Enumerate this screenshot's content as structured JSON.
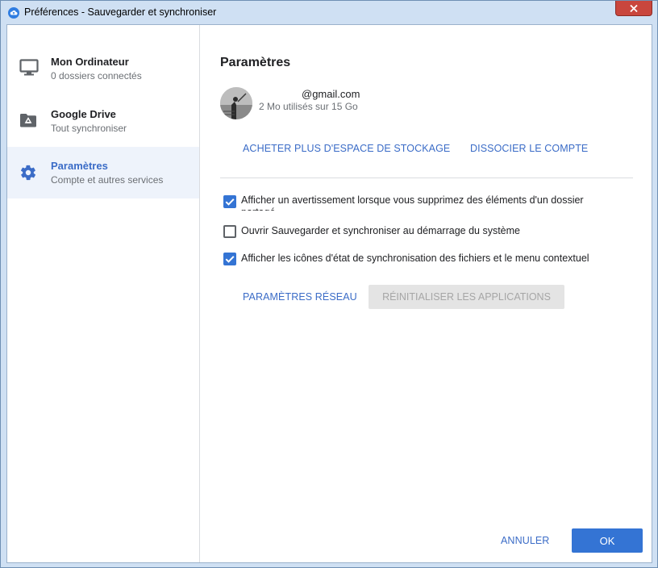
{
  "window": {
    "title": "Préférences - Sauvegarder et synchroniser"
  },
  "sidebar": {
    "items": [
      {
        "title": "Mon Ordinateur",
        "subtitle": "0 dossiers connectés",
        "icon": "monitor-icon"
      },
      {
        "title": "Google Drive",
        "subtitle": "Tout synchroniser",
        "icon": "drive-folder-icon"
      },
      {
        "title": "Paramètres",
        "subtitle": "Compte et autres services",
        "icon": "gear-icon"
      }
    ],
    "active_index": 2
  },
  "settings": {
    "heading": "Paramètres",
    "account": {
      "email": "@gmail.com",
      "usage": "2 Mo utilisés sur 15 Go"
    },
    "buy_storage": "ACHETER PLUS D'ESPACE DE STOCKAGE",
    "disconnect": "DISSOCIER LE COMPTE",
    "options": [
      {
        "label": "Afficher un avertissement lorsque vous supprimez des éléments d'un dossier partagé",
        "checked": true
      },
      {
        "label": "Ouvrir Sauvegarder et synchroniser au démarrage du système",
        "checked": false
      },
      {
        "label": "Afficher les icônes d'état de synchronisation des fichiers et le menu contextuel",
        "checked": true
      }
    ],
    "network_settings": "PARAMÈTRES RÉSEAU",
    "reset_apps": "RÉINITIALISER LES APPLICATIONS"
  },
  "footer": {
    "cancel": "ANNULER",
    "ok": "OK"
  },
  "colors": {
    "accent": "#3474d4",
    "link": "#3b6cc7",
    "active_bg": "#eef3fb"
  }
}
